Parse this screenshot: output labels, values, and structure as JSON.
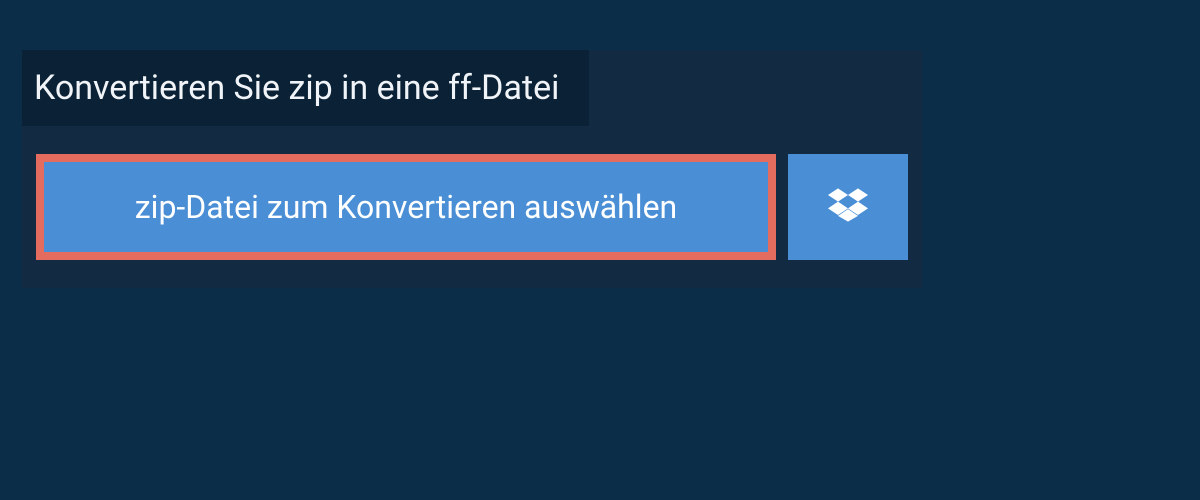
{
  "panel": {
    "title": "Konvertieren Sie zip in eine ff-Datei",
    "select_button_label": "zip-Datei zum Konvertieren auswählen"
  }
}
